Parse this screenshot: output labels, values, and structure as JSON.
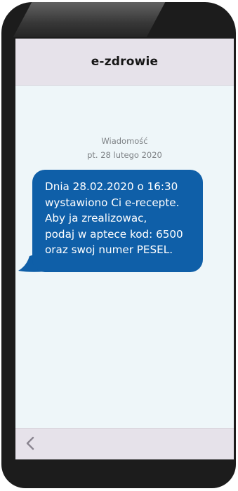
{
  "app": {
    "title": "e-zdrowie"
  },
  "message": {
    "label": "Wiadomość",
    "date": "pt. 28 lutego 2020",
    "lines": [
      "Dnia 28.02.2020 o 16:30",
      "wystawiono Ci e-recepte.",
      "Aby ja zrealizowac,",
      "podaj w aptece kod: 6500",
      "oraz swoj numer PESEL."
    ]
  },
  "navigation": {
    "back_icon": "chevron-left-icon"
  },
  "colors": {
    "bubble": "#0f5fa8",
    "screen_background": "#eef6f9",
    "bar_background": "#e6e2ea",
    "phone_frame": "#1c1c1c"
  }
}
